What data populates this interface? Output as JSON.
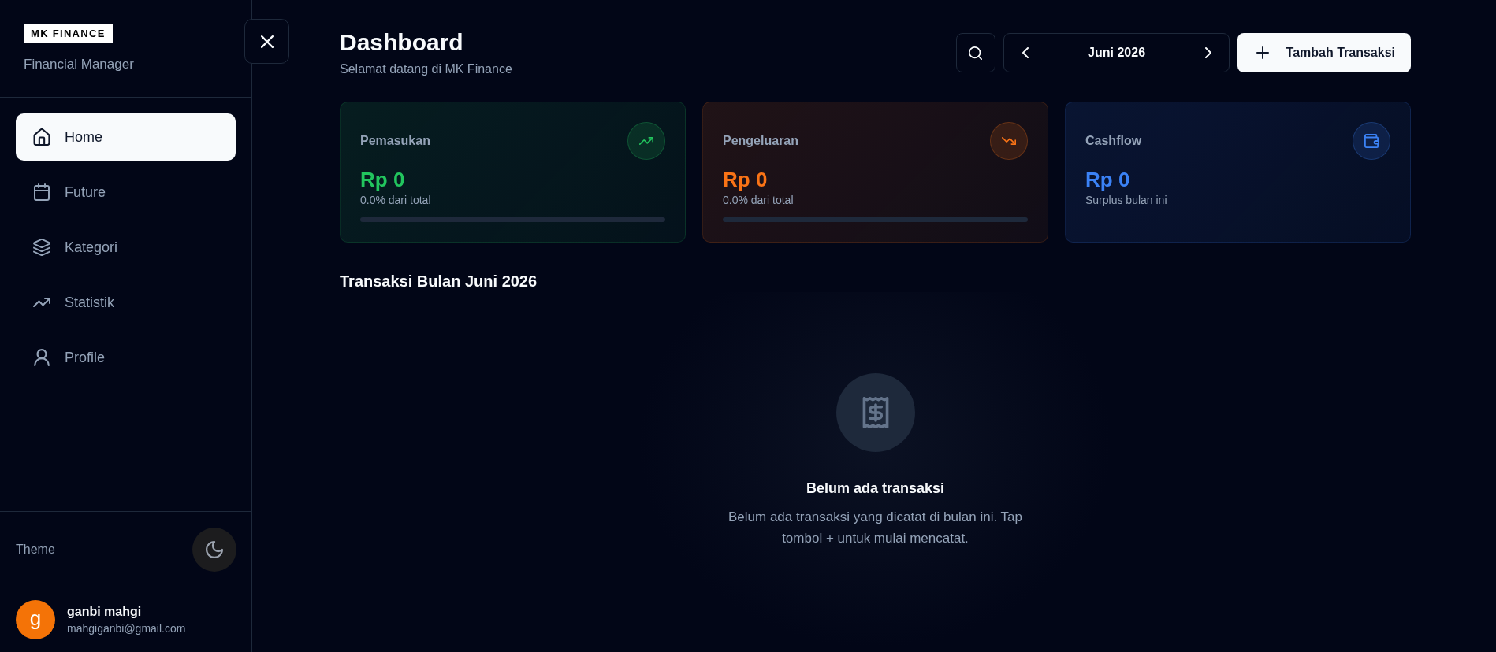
{
  "sidebar": {
    "logo": "MK FINANCE",
    "subtitle": "Financial Manager",
    "items": [
      {
        "label": "Home",
        "selected": true
      },
      {
        "label": "Future",
        "selected": false
      },
      {
        "label": "Kategori",
        "selected": false
      },
      {
        "label": "Statistik",
        "selected": false
      },
      {
        "label": "Profile",
        "selected": false
      }
    ],
    "theme_label": "Theme",
    "user": {
      "initial": "g",
      "name": "ganbi mahgi",
      "email": "mahgiganbi@gmail.com"
    }
  },
  "header": {
    "title": "Dashboard",
    "subtitle": "Selamat datang di MK Finance",
    "month": "Juni 2026",
    "add_button": "Tambah Transaksi"
  },
  "cards": [
    {
      "label": "Pemasukan",
      "amount": "Rp 0",
      "note": "0.0% dari total",
      "level": 0,
      "color": "#22c55e"
    },
    {
      "label": "Pengeluaran",
      "amount": "Rp 0",
      "note": "0.0% dari total",
      "level": 0,
      "color": "#f97316"
    },
    {
      "label": "Cashflow",
      "amount": "Rp 0",
      "note": "Surplus bulan ini",
      "color": "#3b82f6"
    }
  ],
  "transactions": {
    "title": "Transaksi Bulan Juni 2026",
    "empty_title": "Belum ada transaksi",
    "empty_text": "Belum ada transaksi yang dicatat di bulan ini. Tap tombol + untuk mulai mencatat."
  }
}
